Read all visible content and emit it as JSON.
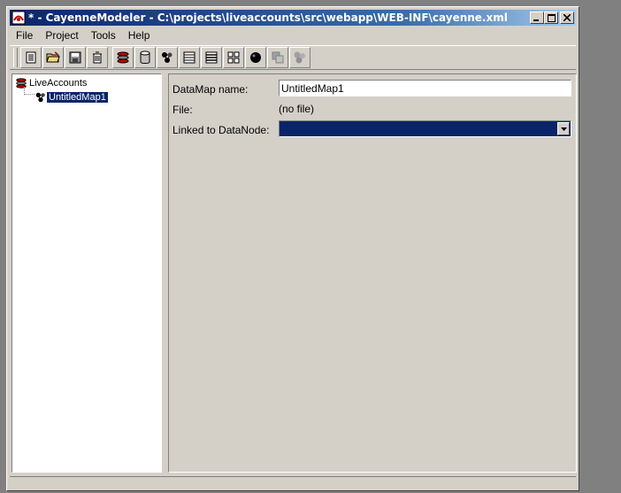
{
  "window": {
    "title": "* - CayenneModeler - C:\\projects\\liveaccounts\\src\\webapp\\WEB-INF\\cayenne.xml",
    "icon": "cayenne-app-icon"
  },
  "menubar": {
    "items": [
      "File",
      "Project",
      "Tools",
      "Help"
    ]
  },
  "toolbar": {
    "buttons": [
      {
        "icon": "new-project-icon"
      },
      {
        "icon": "open-project-icon"
      },
      {
        "icon": "save-project-icon"
      },
      {
        "icon": "remove-icon"
      },
      {
        "icon": "create-domain-icon"
      },
      {
        "icon": "create-datanode-icon"
      },
      {
        "icon": "create-datamap-icon"
      },
      {
        "icon": "create-obj-entity-icon"
      },
      {
        "icon": "create-db-entity-icon"
      },
      {
        "icon": "create-procedure-icon"
      },
      {
        "icon": "create-query-icon"
      },
      {
        "icon": "obj-relationship-icon"
      },
      {
        "icon": "db-relationship-icon"
      }
    ]
  },
  "tree": {
    "root": {
      "label": "LiveAccounts",
      "icon": "domain-icon"
    },
    "children": [
      {
        "label": "UntitledMap1",
        "icon": "datamap-icon",
        "selected": true
      }
    ]
  },
  "detail": {
    "datamap_name_label": "DataMap name:",
    "datamap_name_value": "UntitledMap1",
    "file_label": "File:",
    "file_value": "(no file)",
    "linked_label": "Linked to DataNode:",
    "linked_value": ""
  },
  "colors": {
    "selection": "#0a246a",
    "face": "#d4d0c8",
    "desktop": "#808080"
  }
}
